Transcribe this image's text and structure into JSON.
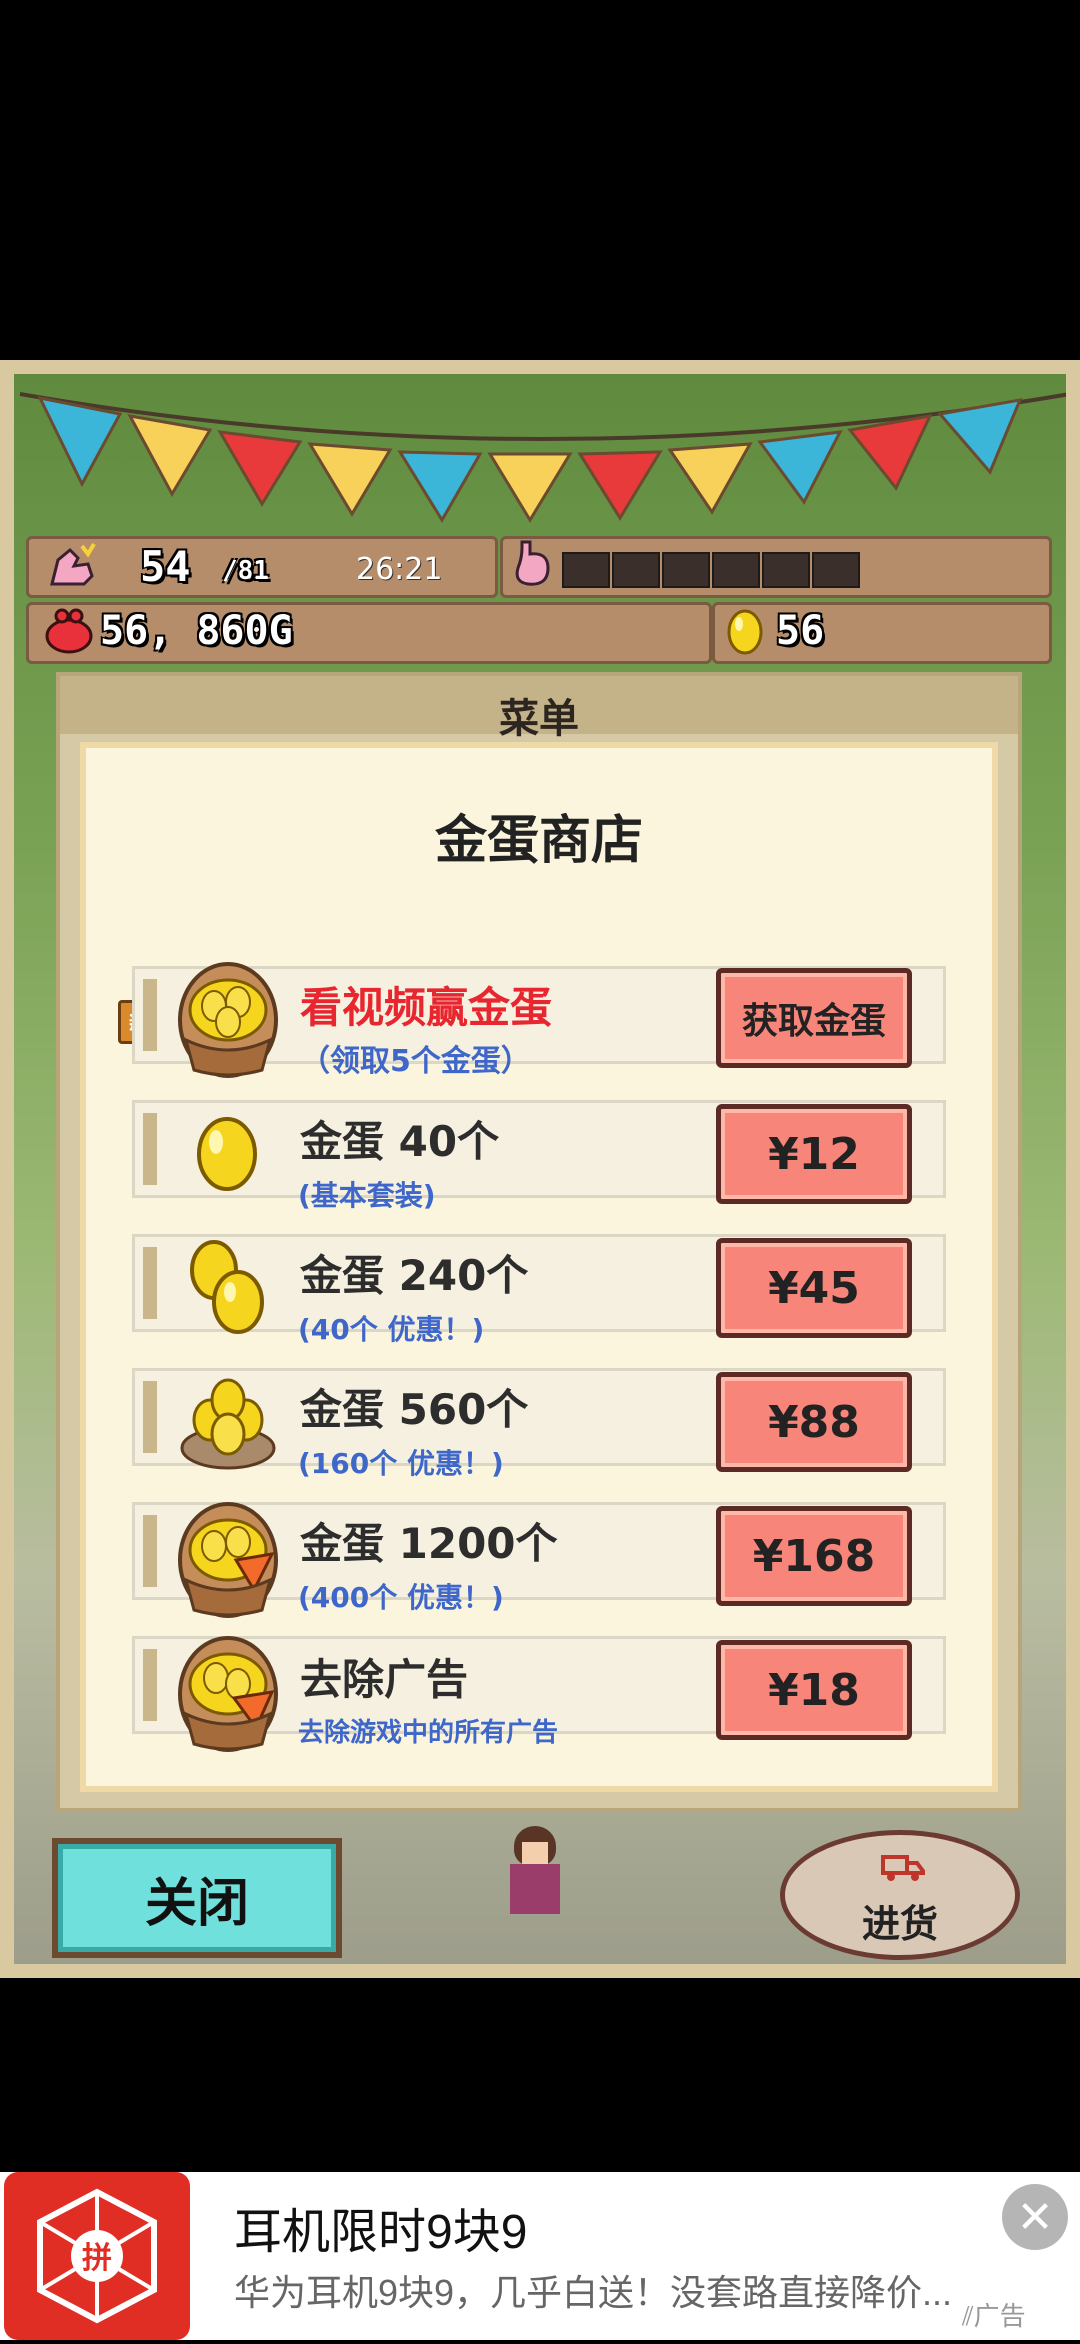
{
  "hud": {
    "stamina": "54",
    "stamina_max": "/81",
    "timer": "26:21",
    "money": "56, 860G",
    "eggs": "56"
  },
  "menu": {
    "title": "菜单"
  },
  "shop": {
    "title": "金蛋商店",
    "new_badge": "新",
    "items": [
      {
        "title": "看视频赢金蛋",
        "subtitle": "（领取5个金蛋）",
        "button": "获取金蛋",
        "icon": "basket-eggs-icon"
      },
      {
        "title": "金蛋 40个",
        "subtitle": "(基本套装)",
        "button": "¥12",
        "icon": "golden-egg-icon"
      },
      {
        "title": "金蛋 240个",
        "subtitle": "(40个 优惠！)",
        "button": "¥45",
        "icon": "two-golden-eggs-icon"
      },
      {
        "title": "金蛋 560个",
        "subtitle": "(160个 优惠！)",
        "button": "¥88",
        "icon": "nest-eggs-icon"
      },
      {
        "title": "金蛋 1200个",
        "subtitle": "(400个 优惠！)",
        "button": "¥168",
        "icon": "basket-eggs-icon"
      },
      {
        "title": "去除广告",
        "subtitle": "去除游戏中的所有广告",
        "button": "¥18",
        "icon": "basket-eggs-icon"
      }
    ]
  },
  "buttons": {
    "close": "关闭",
    "restock": "进货"
  },
  "ad": {
    "title": "耳机限时9块9",
    "description": "华为耳机9块9，几乎白送！没套路直接降价...",
    "tag": "广告",
    "close": "✕"
  },
  "colors": {
    "price_button": "#f7857a",
    "close_button": "#6fe0dc",
    "highlight_title": "#e8262f",
    "subtitle_blue": "#3e67c9",
    "ad_brand": "#e02e24"
  }
}
